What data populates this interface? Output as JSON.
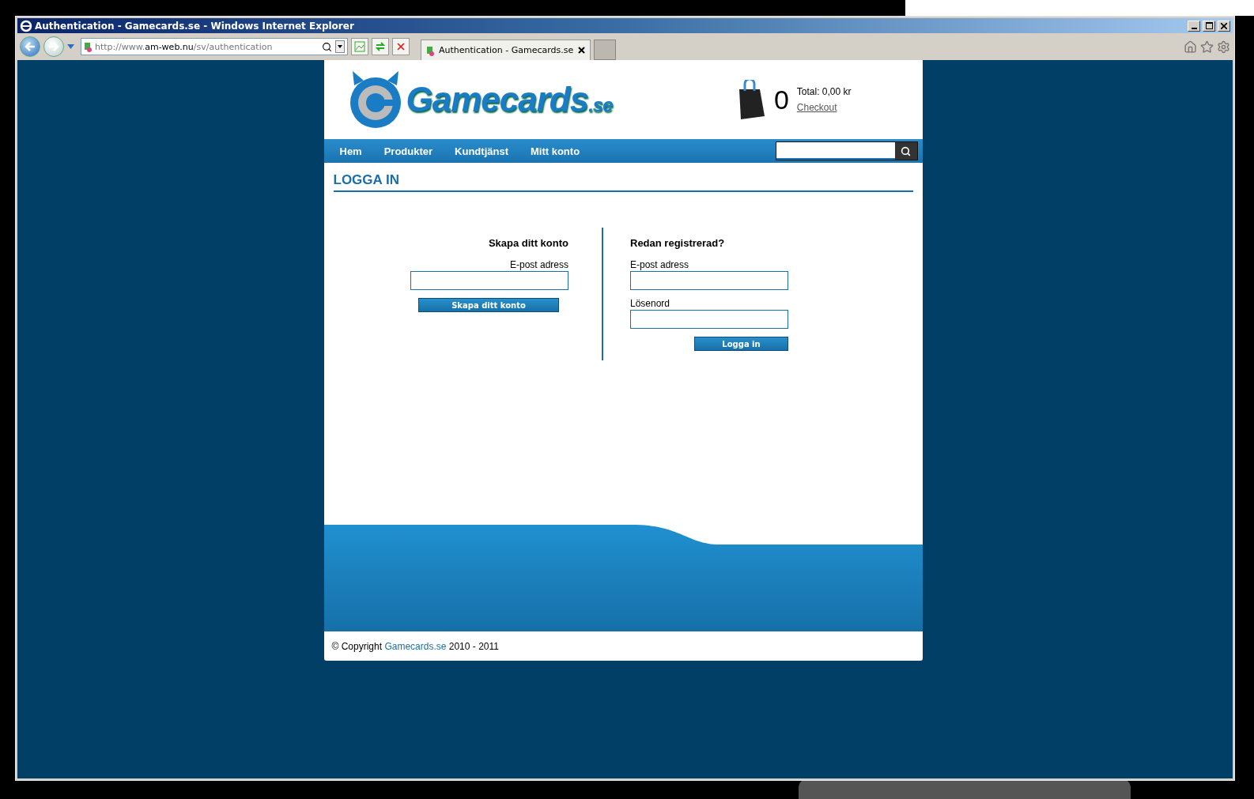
{
  "window": {
    "title": "Authentication - Gamecards.se - Windows Internet Explorer"
  },
  "address_bar": {
    "url_prefix": "http://www.",
    "url_domain": "am-web.nu",
    "url_path": "/sv/authentication"
  },
  "tabs": [
    {
      "label": "Authentication - Gamecards.se",
      "selected": true
    }
  ],
  "site": {
    "logo": {
      "name": "Gamecards",
      "suffix": ".se"
    },
    "cart": {
      "count": "0",
      "total": "Total: 0,00 kr",
      "checkout": "Checkout"
    },
    "nav": [
      "Hem",
      "Produkter",
      "Kundtjänst",
      "Mitt konto"
    ],
    "page_title": "LOGGA IN",
    "register": {
      "heading": "Skapa ditt konto",
      "email_label": "E-post adress",
      "button": "Skapa ditt konto"
    },
    "login": {
      "heading": "Redan registrerad?",
      "email_label": "E-post adress",
      "password_label": "Lösenord",
      "button": "Logga in"
    },
    "footer": {
      "prefix": "© Copyright",
      "link": "Gamecards.se",
      "years": "2010 - 2011"
    }
  }
}
